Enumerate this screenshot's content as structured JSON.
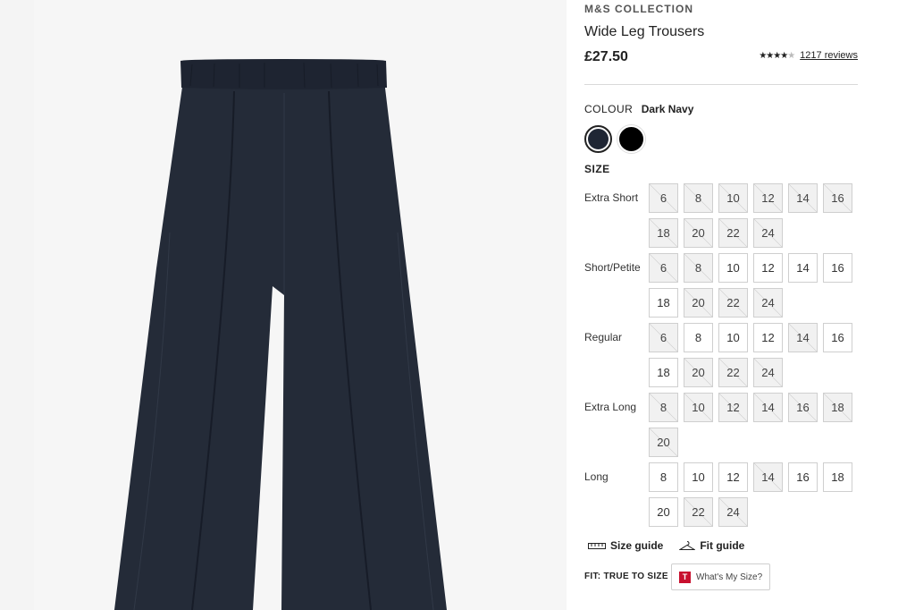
{
  "product": {
    "brand": "M&S COLLECTION",
    "title": "Wide Leg Trousers",
    "price": "£27.50",
    "rating": {
      "stars": 4,
      "max": 5,
      "reviews_label": "1217 reviews"
    }
  },
  "colour": {
    "label": "COLOUR",
    "selected": "Dark Navy",
    "swatches": [
      {
        "name": "Dark Navy",
        "color": "#1f2634"
      },
      {
        "name": "Black",
        "color": "#000000"
      }
    ]
  },
  "size": {
    "heading": "SIZE",
    "groups": [
      {
        "label": "Extra Short",
        "sizes": [
          {
            "v": "6",
            "oos": true
          },
          {
            "v": "8",
            "oos": true
          },
          {
            "v": "10",
            "oos": true
          },
          {
            "v": "12",
            "oos": true
          },
          {
            "v": "14",
            "oos": true
          },
          {
            "v": "16",
            "oos": true
          },
          {
            "v": "18",
            "oos": true
          },
          {
            "v": "20",
            "oos": true
          },
          {
            "v": "22",
            "oos": true
          },
          {
            "v": "24",
            "oos": true
          }
        ]
      },
      {
        "label": "Short/Petite",
        "sizes": [
          {
            "v": "6",
            "oos": true
          },
          {
            "v": "8",
            "oos": true
          },
          {
            "v": "10",
            "oos": false
          },
          {
            "v": "12",
            "oos": false
          },
          {
            "v": "14",
            "oos": false
          },
          {
            "v": "16",
            "oos": false
          },
          {
            "v": "18",
            "oos": false
          },
          {
            "v": "20",
            "oos": true
          },
          {
            "v": "22",
            "oos": true
          },
          {
            "v": "24",
            "oos": true
          }
        ]
      },
      {
        "label": "Regular",
        "sizes": [
          {
            "v": "6",
            "oos": true
          },
          {
            "v": "8",
            "oos": false
          },
          {
            "v": "10",
            "oos": false
          },
          {
            "v": "12",
            "oos": false
          },
          {
            "v": "14",
            "oos": true
          },
          {
            "v": "16",
            "oos": false
          },
          {
            "v": "18",
            "oos": false
          },
          {
            "v": "20",
            "oos": true
          },
          {
            "v": "22",
            "oos": true
          },
          {
            "v": "24",
            "oos": true
          }
        ]
      },
      {
        "label": "Extra Long",
        "sizes": [
          {
            "v": "8",
            "oos": true
          },
          {
            "v": "10",
            "oos": true
          },
          {
            "v": "12",
            "oos": true
          },
          {
            "v": "14",
            "oos": true
          },
          {
            "v": "16",
            "oos": true
          },
          {
            "v": "18",
            "oos": true
          },
          {
            "v": "20",
            "oos": true
          }
        ]
      },
      {
        "label": "Long",
        "sizes": [
          {
            "v": "8",
            "oos": false
          },
          {
            "v": "10",
            "oos": false
          },
          {
            "v": "12",
            "oos": false
          },
          {
            "v": "14",
            "oos": true
          },
          {
            "v": "16",
            "oos": false
          },
          {
            "v": "18",
            "oos": false
          },
          {
            "v": "20",
            "oos": false
          },
          {
            "v": "22",
            "oos": true
          },
          {
            "v": "24",
            "oos": true
          }
        ]
      }
    ]
  },
  "guides": {
    "size_guide": "Size guide",
    "fit_guide": "Fit guide",
    "fit_label": "FIT: TRUE TO SIZE",
    "whats_my_size": "What's My Size?",
    "wms_badge": "T"
  }
}
